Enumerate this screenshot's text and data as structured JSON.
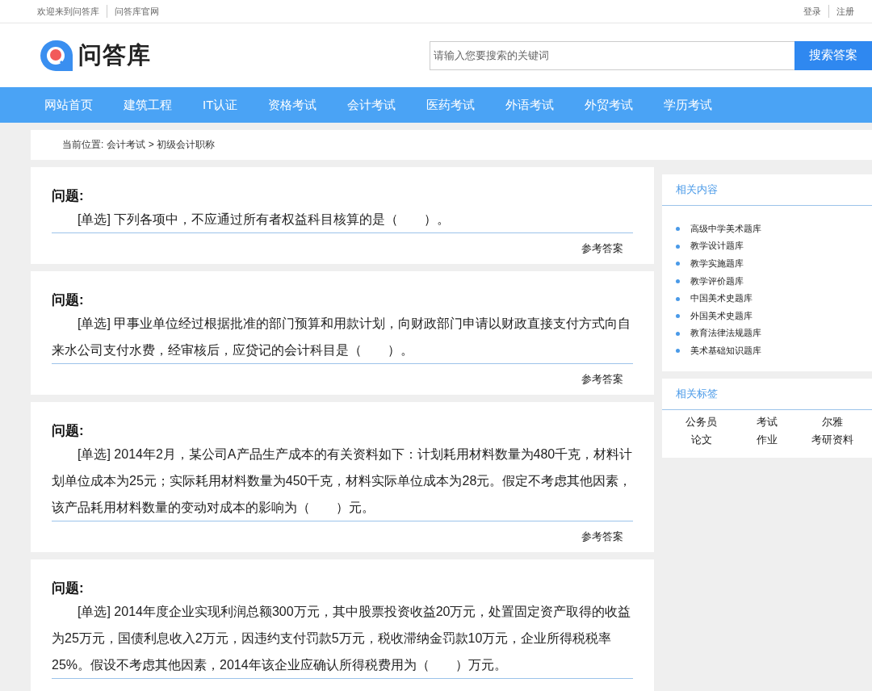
{
  "top_bar": {
    "left_links": [
      "欢迎来到问答库",
      "问答库官网"
    ],
    "right_links": [
      "登录",
      "注册"
    ]
  },
  "header": {
    "logo_text": "问答库",
    "search": {
      "placeholder": "请输入您要搜索的关键词"
    },
    "search_button": "搜索答案"
  },
  "nav": [
    {
      "label": "网站首页",
      "selected": false
    },
    {
      "label": "建筑工程",
      "selected": false
    },
    {
      "label": "IT认证",
      "selected": false
    },
    {
      "label": "资格考试",
      "selected": false
    },
    {
      "label": "会计考试",
      "selected": false
    },
    {
      "label": "医药考试",
      "selected": false
    },
    {
      "label": "外语考试",
      "selected": false
    },
    {
      "label": "外贸考试",
      "selected": false
    },
    {
      "label": "学历考试",
      "selected": false
    }
  ],
  "breadcrumb": {
    "label": "当前位置:",
    "path": "会计考试 > 初级会计职称"
  },
  "questions": [
    {
      "heading": "问题:",
      "text": "[单选] 下列各项中，不应通过所有者权益科目核算的是（　　）。",
      "answer_link": "参考答案"
    },
    {
      "heading": "问题:",
      "text": "[单选] 甲事业单位经过根据批准的部门预算和用款计划，向财政部门申请以财政直接支付方式向自来水公司支付水费，经审核后，应贷记的会计科目是（　　）。",
      "answer_link": "参考答案"
    },
    {
      "heading": "问题:",
      "text": "[单选] 2014年2月，某公司A产品生产成本的有关资料如下：计划耗用材料数量为480千克，材料计划单位成本为25元；实际耗用材料数量为450千克，材料实际单位成本为28元。假定不考虑其他因素，该产品耗用材料数量的变动对成本的影响为（　　）元。",
      "answer_link": "参考答案"
    },
    {
      "heading": "问题:",
      "text": "[单选] 2014年度企业实现利润总额300万元，其中股票投资收益20万元，处置固定资产取得的收益为25万元，国债利息收入2万元，因违约支付罚款5万元，税收滞纳金罚款10万元，企业所得税税率25%。假设不考虑其他因素，2014年该企业应确认所得税费用为（　　）万元。"
    }
  ],
  "sidebar": {
    "related_content": {
      "title": "相关内容",
      "items": [
        "高级中学美术题库",
        "教学设计题库",
        "教学实施题库",
        "教学评价题库",
        "中国美术史题库",
        "外国美术史题库",
        "教育法律法规题库",
        "美术基础知识题库"
      ]
    },
    "related_tags": {
      "title": "相关标签",
      "tags": [
        "公务员",
        "考试",
        "尔雅",
        "论文",
        "作业",
        "考研资料"
      ]
    }
  }
}
